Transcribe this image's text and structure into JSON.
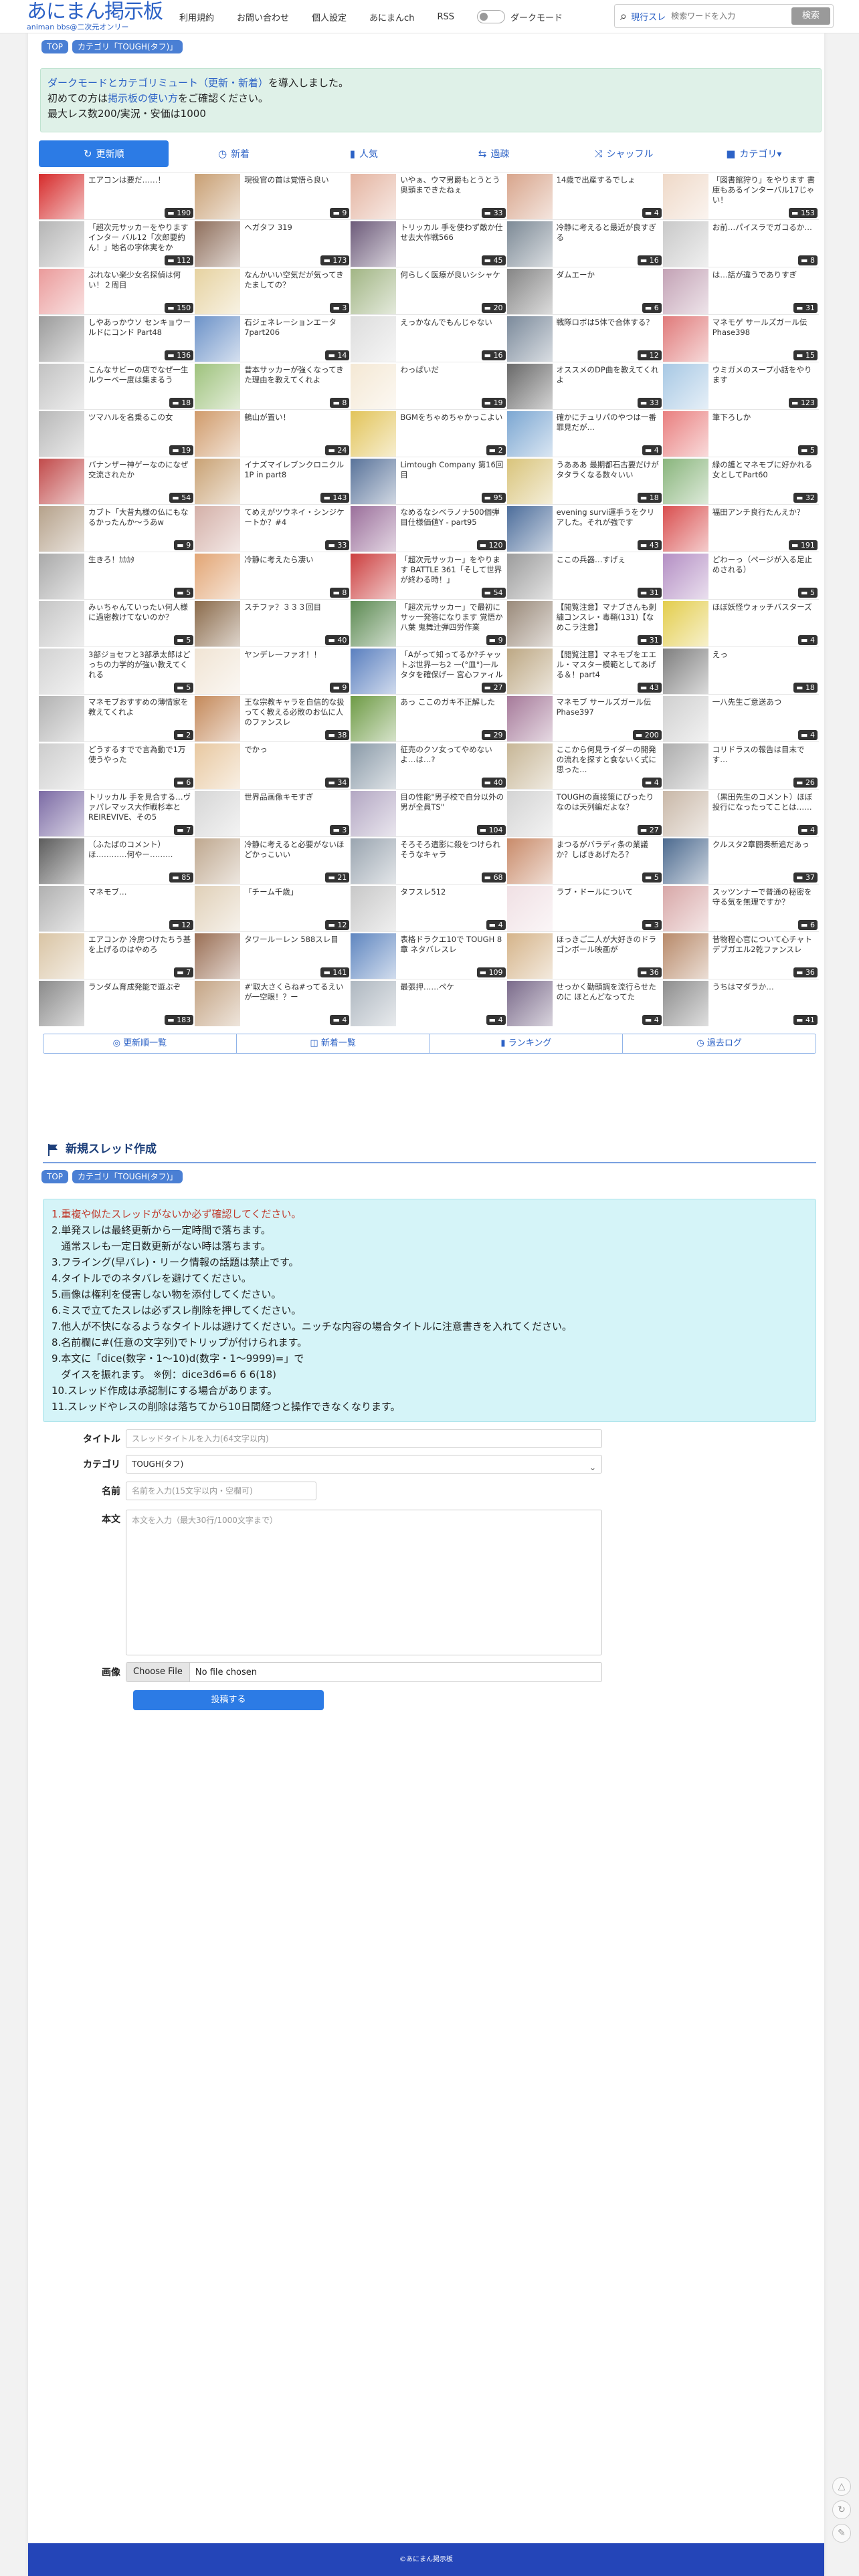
{
  "header": {
    "logo_main": "あにまん掲示板",
    "logo_sub": "animan bbs@二次元オンリー",
    "nav": [
      "利用規約",
      "お問い合わせ",
      "個人設定",
      "あにまんch",
      "RSS"
    ],
    "dark_mode_label": "ダークモード",
    "search_scope": "現行スレ",
    "search_placeholder": "検索ワードを入力",
    "search_button": "検索"
  },
  "breadcrumbs": {
    "top": "TOP",
    "category": "カテゴリ「TOUGH(タフ)」"
  },
  "notice": {
    "line1_link": "ダークモードとカテゴリミュート（更新・新着）",
    "line1_rest": "を導入しました。",
    "line2_pre": "初めての方は",
    "line2_link": "掲示板の使い方",
    "line2_rest": "をご確認ください。",
    "line3": "最大レス数200/実況・安価は1000"
  },
  "tabs": [
    {
      "icon": "↻",
      "label": "更新順"
    },
    {
      "icon": "◷",
      "label": "新着"
    },
    {
      "icon": "▮",
      "label": "人気"
    },
    {
      "icon": "⇆",
      "label": "過疎"
    },
    {
      "icon": "⤨",
      "label": "シャッフル"
    },
    {
      "icon": "■",
      "label": "カテゴリ▾"
    }
  ],
  "threads": [
    {
      "title": "エアコンは要だ……！",
      "count": "190",
      "color": "#d62b2b"
    },
    {
      "title": "現役官の首は覚悟ら良い",
      "count": "9",
      "color": "#c89f73"
    },
    {
      "title": "いやぁ、ウマ男爵もとうとう奥頭まできたねぇ",
      "count": "33",
      "color": "#e4b4a1"
    },
    {
      "title": "14歳で出産するでしょ",
      "count": "4",
      "color": "#d8a58c"
    },
    {
      "title": "「図書館狩り」をやります 書庫もあるインターバル17じゃい！",
      "count": "153",
      "color": "#efd9c8"
    },
    {
      "title": "「超次元サッカーをやりますインター バル12「次郎要約ん！」地名の字体実をかな！！」",
      "count": "112",
      "color": "#b5b5b5"
    },
    {
      "title": "ヘガタフ 319",
      "count": "173",
      "color": "#8f6f5c"
    },
    {
      "title": "トリッカル 手を使わず敵か仕せ去大作戦566",
      "count": "45",
      "color": "#6d5b7a"
    },
    {
      "title": "冷静に考えると最近が良すぎる",
      "count": "16",
      "color": "#7d8a96"
    },
    {
      "title": "お前…パイスラでガコるか…",
      "count": "8",
      "color": "#c9c9c9"
    },
    {
      "title": "ぶれない楽少女名探偵は何い！２周目",
      "count": "150",
      "color": "#ea9a9a"
    },
    {
      "title": "なんかいい空気だが気ってきたましての？",
      "count": "3",
      "color": "#e6d2a0"
    },
    {
      "title": "何らしく医療が良いシシャケ",
      "count": "20",
      "color": "#a1b584"
    },
    {
      "title": "ダムエーか",
      "count": "6",
      "color": "#858585"
    },
    {
      "title": "は…話が違うでありすぎ",
      "count": "31",
      "color": "#c3a2b5"
    },
    {
      "title": "しやあっかウソ センキョウールドにコンド Part48",
      "count": "136",
      "color": "#9b9b9b"
    },
    {
      "title": "石ジェネレーションエータ7part206",
      "count": "14",
      "color": "#6c92c8"
    },
    {
      "title": "えっかなんでもんじゃない",
      "count": "16",
      "color": "#dddddd"
    },
    {
      "title": "戦隊ロボは5体で合体する？",
      "count": "12",
      "color": "#7b8a9b"
    },
    {
      "title": "マネモゲ サールズガール伝Phase398",
      "count": "15",
      "color": "#e07a7a"
    },
    {
      "title": "こんなサビーの店でなぜ一生ルウーベ一度は集まるう",
      "count": "18",
      "color": "#c2c2c2"
    },
    {
      "title": "昔本サッカーが強くなってきた理由を教えてくれよ",
      "count": "8",
      "color": "#9ec27c"
    },
    {
      "title": "わっぱいだ",
      "count": "19",
      "color": "#f4e8d4"
    },
    {
      "title": "オススメのDP曲を教えてくれよ",
      "count": "33",
      "color": "#686868"
    },
    {
      "title": "ウミガメのスープ小話をやります",
      "count": "123",
      "color": "#a7c8e4"
    },
    {
      "title": "ツマハルを名乗るこの女",
      "count": "19",
      "color": "#b8b8b8"
    },
    {
      "title": "鶴山が置い！",
      "count": "24",
      "color": "#d09b6b"
    },
    {
      "title": "BGMをちゃめちゃかっこよい",
      "count": "2",
      "color": "#e2c45a"
    },
    {
      "title": "確かにチュリパのやつは一番罪見だが…",
      "count": "4",
      "color": "#7ca7d2"
    },
    {
      "title": "筆下ろしか",
      "count": "5",
      "color": "#e97f7f"
    },
    {
      "title": "バナンザー神ゲーなのになぜ交流されたか",
      "count": "54",
      "color": "#c14a4a"
    },
    {
      "title": "イナズマイレブンクロニクル 1P in part8",
      "count": "143",
      "color": "#c9a274"
    },
    {
      "title": "Limtough Company 第16回目",
      "count": "95",
      "color": "#59739a"
    },
    {
      "title": "うあああ 最期都石古要だけがタタラくなる数々いい",
      "count": "18",
      "color": "#d9c47b"
    },
    {
      "title": "緑の護とマネモブに好かれる女としてPart60",
      "count": "32",
      "color": "#89b57c"
    },
    {
      "title": "カブト「大昔丸様の仏にもなるかったんか～うあw",
      "count": "9",
      "color": "#b5a18a"
    },
    {
      "title": "てめえがツウネイ・シンジケートか？#4",
      "count": "33",
      "color": "#d4b0a8"
    },
    {
      "title": "なめるなシベラノナ500個弾目仕様価値Y - part95",
      "count": "120",
      "color": "#9b6f9b"
    },
    {
      "title": "evening survi運手うをクリアした。それが強です",
      "count": "43",
      "color": "#4c6d9b"
    },
    {
      "title": "福田アンチ良行たんえか？",
      "count": "191",
      "color": "#d94f4f"
    },
    {
      "title": "生きろ！ｶｶｶﾀ",
      "count": "5",
      "color": "#a9a9a9"
    },
    {
      "title": "冷静に考えたら凄い",
      "count": "8",
      "color": "#e2a574"
    },
    {
      "title": "「超次元サッカー」をやります BATTLE 361「そして世界が終わる時！」",
      "count": "54",
      "color": "#cc3f3f"
    },
    {
      "title": "ここの兵器…すげぇ",
      "count": "31",
      "color": "#9c9c9c"
    },
    {
      "title": "どわーっ（ページが入る足止めされる）",
      "count": "5",
      "color": "#b48fc4"
    },
    {
      "title": "みぃちゃんていったい何人様に過密教けてないのか？",
      "count": "5",
      "color": "#c5c5c5"
    },
    {
      "title": "スチファ？３３３回目",
      "count": "40",
      "color": "#8a6a4a"
    },
    {
      "title": "「超次元サッカー」で最初にサッ一発答になります 覚悟か八葉 鬼舞辻弾四労作業",
      "count": "9",
      "color": "#5c8a52"
    },
    {
      "title": "【閲覧注意】マナブさんも刺繍コンスレ・毒鞘(131)【なめこラ注意】",
      "count": "31",
      "color": "#9a8a7a"
    },
    {
      "title": "ほぼ妖怪ウォッチバスターズ",
      "count": "4",
      "color": "#e3cd4c"
    },
    {
      "title": "3部ジョセフと3部承太郎はどっちの力学的が強い教えてくれる",
      "count": "5",
      "color": "#d2d2d2"
    },
    {
      "title": "ヤンデレ一ファオ！！",
      "count": "9",
      "color": "#f0e4d4"
    },
    {
      "title": "「Aがって知ってるか?チャットぷ世界一ち2 一(°皿°)一ルタタを確保げ一 宮心ファィルターぞ！」",
      "count": "27",
      "color": "#5a7fbf"
    },
    {
      "title": "【閲覧注意】マネモブをエエル・マスター模範としてあげる＆！part4",
      "count": "43",
      "color": "#bda884"
    },
    {
      "title": "えっ",
      "count": "18",
      "color": "#7f7f7f"
    },
    {
      "title": "マネモブおすすめの薄情家を教えてくれよ",
      "count": "2",
      "color": "#b2b2b2"
    },
    {
      "title": "王な宗教キャラを自信的な扱ってく教える必敗のお仏に人のファンスレ",
      "count": "38",
      "color": "#c4895a"
    },
    {
      "title": "あっ ここのガキ不正解した",
      "count": "29",
      "color": "#6e9b45"
    },
    {
      "title": "マネモブ サールズガール伝Phase397",
      "count": "200",
      "color": "#a67a9a"
    },
    {
      "title": "一八先生ご意送あつ",
      "count": "4",
      "color": "#d0d0d0"
    },
    {
      "title": "どうするすでで言為動で1万使うやった",
      "count": "6",
      "color": "#cdcdcd"
    },
    {
      "title": "でかっ",
      "count": "34",
      "color": "#e8c8a0"
    },
    {
      "title": "征売のクソ女ってやめないよ…は…?",
      "count": "40",
      "color": "#8a9aa8"
    },
    {
      "title": "ここから何見ライダーの開発の流れを探すと食ないく式に思った…",
      "count": "4",
      "color": "#c7b696"
    },
    {
      "title": "コリドラスの報告は目末です…",
      "count": "26",
      "color": "#adadad"
    },
    {
      "title": "トリッカル 手を見合する…ヴァパレマッス大作戦杉本とREIREVIVE、その5",
      "count": "7",
      "color": "#7b6aa4"
    },
    {
      "title": "世界品画像キモすぎ",
      "count": "3",
      "color": "#d6d6d6"
    },
    {
      "title": "目の性能\"男子校で自分以外の男が全員TS\"",
      "count": "104",
      "color": "#b3a7c3"
    },
    {
      "title": "TOUGHの直接策にぴったりなのは天列編だよな？",
      "count": "27",
      "color": "#d4d4d4"
    },
    {
      "title": "（黒田先生のコメント）ほぼ投行になったってことは……",
      "count": "4",
      "color": "#c9b8a8"
    },
    {
      "title": "（ふたばのコメント）ほ…………何やー………",
      "count": "85",
      "color": "#5c5c5c"
    },
    {
      "title": "冷静に考えると必要がないほどかっこいい",
      "count": "21",
      "color": "#bfa88f"
    },
    {
      "title": "そろそろ遺影に殺をつけられそうなキャラ",
      "count": "68",
      "color": "#9aa5b0"
    },
    {
      "title": "まつるがバラディ条の業議か？しばきあげたろ？",
      "count": "5",
      "color": "#c98b6a"
    },
    {
      "title": "クルスタ2章闘奏新追だあっ",
      "count": "37",
      "color": "#4c6a8f"
    },
    {
      "title": "マネモブ…",
      "count": "12",
      "color": "#b0b0b0"
    },
    {
      "title": "「チーム千歳」",
      "count": "12",
      "color": "#e0d0b8"
    },
    {
      "title": "タフスレ512",
      "count": "4",
      "color": "#c8c8c8"
    },
    {
      "title": "ラブ・ドールについて",
      "count": "3",
      "color": "#f0e0e4"
    },
    {
      "title": "スッツンナーで普通の秘密を守る気を無理ですか？",
      "count": "6",
      "color": "#d8a8a8"
    },
    {
      "title": "エアコンか 冷房つけたちう基を上げるのはやめろ",
      "count": "7",
      "color": "#d9c4a4"
    },
    {
      "title": "タワールーレン 588スレ目",
      "count": "141",
      "color": "#9a6f55"
    },
    {
      "title": "表格ドラクエ10で TOUGH 8章 ネタバレスレ",
      "count": "109",
      "color": "#5f86c0"
    },
    {
      "title": "ほっきご二人が大好きのドラゴンボール映画が",
      "count": "36",
      "color": "#d5b48a"
    },
    {
      "title": "昔物程心官について心チャトデブガエル2乾ファンスレ",
      "count": "36",
      "color": "#b88a6a"
    },
    {
      "title": "ランダム育成発能で遊ぶぞ",
      "count": "183",
      "color": "#8a8a8a"
    },
    {
      "title": "#'取大さくらね#ってるえいが一空眼！？ー",
      "count": "4",
      "color": "#c4a484"
    },
    {
      "title": "最張押……ペケ",
      "count": "4",
      "color": "#aeb7c0"
    },
    {
      "title": "せっかく勤頭調を流行らせたのに ほとんどなってた",
      "count": "4",
      "color": "#7a6a8a"
    },
    {
      "title": "うちはマダラか…",
      "count": "41",
      "color": "#8d8d8d"
    }
  ],
  "bottom_nav": [
    {
      "icon": "◎",
      "label": "更新順一覧"
    },
    {
      "icon": "◫",
      "label": "新着一覧"
    },
    {
      "icon": "▮",
      "label": "ランキング"
    },
    {
      "icon": "◷",
      "label": "過去ログ"
    }
  ],
  "new_thread": {
    "heading": "新規スレッド作成",
    "rules": [
      "1.重複や似たスレッドがないか必ず確認してください。",
      "2.単発スレは最終更新から一定時間で落ちます。\n   通常スレも一定日数更新がない時は落ちます。",
      "3.フライング(早バレ)・リーク情報の話題は禁止です。",
      "4.タイトルでのネタバレを避けてください。",
      "5.画像は権利を侵害しない物を添付してください。",
      "6.ミスで立てたスレは必ずスレ削除を押してください。",
      "7.他人が不快になるようなタイトルは避けてください。ニッチな内容の場合タイトルに注意書きを入れてください。",
      "8.名前欄に#(任意の文字列)でトリップが付けられます。",
      "9.本文に「dice(数字・1〜10)d(数字・1〜9999)=」で\n   ダイスを振れます。 ※例：dice3d6=6 6 6(18)",
      "10.スレッド作成は承認制にする場合があります。",
      "11.スレッドやレスの削除は落ちてから10日間経つと操作できなくなります。"
    ],
    "labels": {
      "title": "タイトル",
      "category": "カテゴリ",
      "name": "名前",
      "body": "本文",
      "image": "画像"
    },
    "placeholders": {
      "title": "スレッドタイトルを入力(64文字以内)",
      "name": "名前を入力(15文字以内・空欄可)",
      "body": "本文を入力（最大30行/1000文字まで）"
    },
    "category_value": "TOUGH(タフ)",
    "file_button": "Choose File",
    "file_status": "No file chosen",
    "submit": "投稿する"
  },
  "side_buttons": [
    "△",
    "↻",
    "✎"
  ],
  "footer": "©あにまん掲示板"
}
